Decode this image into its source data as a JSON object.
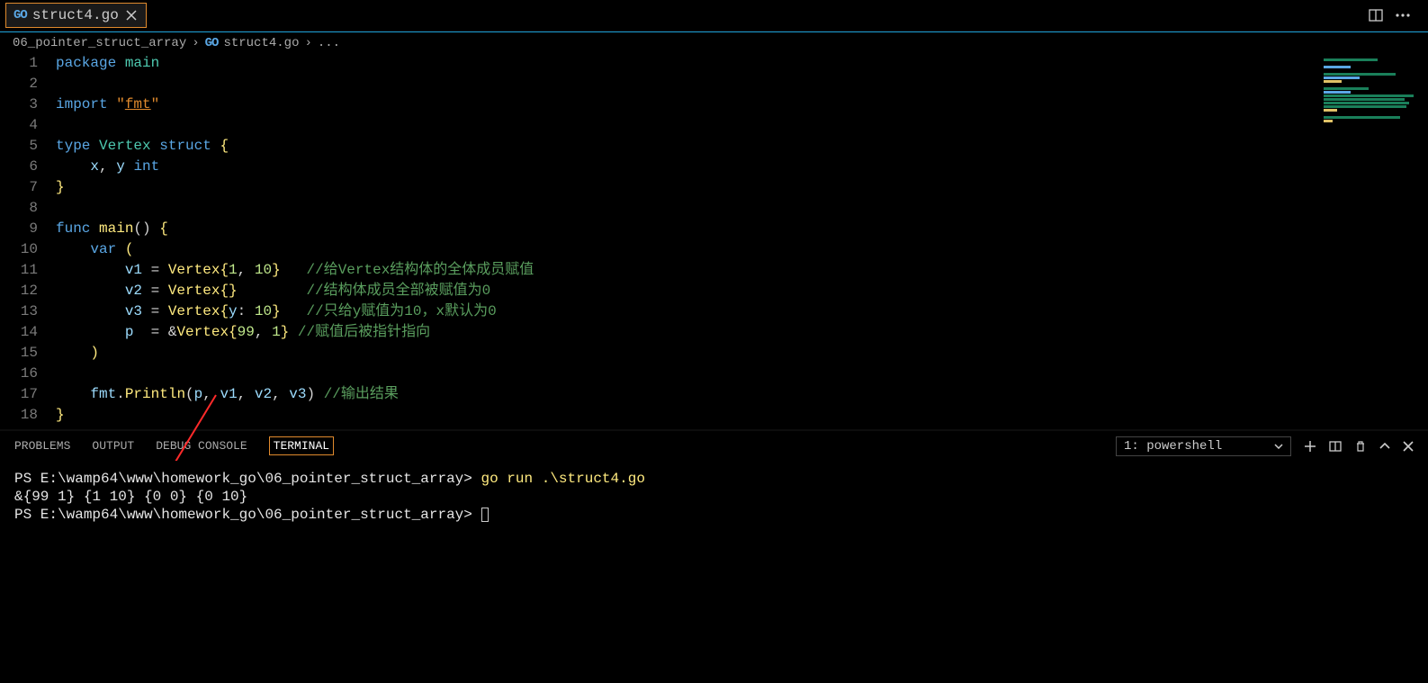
{
  "tabBar": {
    "activeTab": {
      "icon": "GO",
      "label": "struct4.go"
    }
  },
  "breadcrumb": {
    "folder": "06_pointer_struct_array",
    "file": "struct4.go",
    "trail": "..."
  },
  "codeLines": [
    {
      "n": "1",
      "tokens": [
        [
          "kw",
          "package"
        ],
        [
          "pln",
          " "
        ],
        [
          "ty",
          "main"
        ]
      ]
    },
    {
      "n": "2",
      "tokens": []
    },
    {
      "n": "3",
      "tokens": [
        [
          "kw",
          "import"
        ],
        [
          "pln",
          " "
        ],
        [
          "str2",
          "\""
        ],
        [
          "str",
          "fmt"
        ],
        [
          "str2",
          "\""
        ]
      ]
    },
    {
      "n": "4",
      "tokens": []
    },
    {
      "n": "5",
      "tokens": [
        [
          "kw",
          "type"
        ],
        [
          "pln",
          " "
        ],
        [
          "ty",
          "Vertex"
        ],
        [
          "pln",
          " "
        ],
        [
          "kw",
          "struct"
        ],
        [
          "pln",
          " "
        ],
        [
          "brc",
          "{"
        ]
      ]
    },
    {
      "n": "6",
      "tokens": [
        [
          "pln",
          "    "
        ],
        [
          "var",
          "x"
        ],
        [
          "pln",
          ", "
        ],
        [
          "var",
          "y"
        ],
        [
          "pln",
          " "
        ],
        [
          "kw",
          "int"
        ]
      ]
    },
    {
      "n": "7",
      "tokens": [
        [
          "brc",
          "}"
        ]
      ]
    },
    {
      "n": "8",
      "tokens": []
    },
    {
      "n": "9",
      "tokens": [
        [
          "kw",
          "func"
        ],
        [
          "pln",
          " "
        ],
        [
          "fn",
          "main"
        ],
        [
          "pln",
          "() "
        ],
        [
          "brc",
          "{"
        ]
      ]
    },
    {
      "n": "10",
      "tokens": [
        [
          "pln",
          "    "
        ],
        [
          "kw",
          "var"
        ],
        [
          "pln",
          " "
        ],
        [
          "brc",
          "("
        ]
      ]
    },
    {
      "n": "11",
      "tokens": [
        [
          "pln",
          "        "
        ],
        [
          "var",
          "v1"
        ],
        [
          "pln",
          " = "
        ],
        [
          "fn",
          "Vertex"
        ],
        [
          "brc",
          "{"
        ],
        [
          "num",
          "1"
        ],
        [
          "pln",
          ", "
        ],
        [
          "num",
          "10"
        ],
        [
          "brc",
          "}"
        ],
        [
          "pln",
          "   "
        ],
        [
          "com",
          "//给Vertex结构体的全体成员赋值"
        ]
      ]
    },
    {
      "n": "12",
      "tokens": [
        [
          "pln",
          "        "
        ],
        [
          "var",
          "v2"
        ],
        [
          "pln",
          " = "
        ],
        [
          "fn",
          "Vertex"
        ],
        [
          "brc",
          "{}"
        ],
        [
          "pln",
          "        "
        ],
        [
          "com",
          "//结构体成员全部被赋值为0"
        ]
      ]
    },
    {
      "n": "13",
      "tokens": [
        [
          "pln",
          "        "
        ],
        [
          "var",
          "v3"
        ],
        [
          "pln",
          " = "
        ],
        [
          "fn",
          "Vertex"
        ],
        [
          "brc",
          "{"
        ],
        [
          "var",
          "y"
        ],
        [
          "pln",
          ": "
        ],
        [
          "num",
          "10"
        ],
        [
          "brc",
          "}"
        ],
        [
          "pln",
          "   "
        ],
        [
          "com",
          "//只给y赋值为10，x默认为0"
        ]
      ]
    },
    {
      "n": "14",
      "tokens": [
        [
          "pln",
          "        "
        ],
        [
          "var",
          "p"
        ],
        [
          "pln",
          "  = "
        ],
        [
          "op",
          "&"
        ],
        [
          "fn",
          "Vertex"
        ],
        [
          "brc",
          "{"
        ],
        [
          "num",
          "99"
        ],
        [
          "pln",
          ", "
        ],
        [
          "num",
          "1"
        ],
        [
          "brc",
          "}"
        ],
        [
          "pln",
          " "
        ],
        [
          "com",
          "//赋值后被指针指向"
        ]
      ]
    },
    {
      "n": "15",
      "tokens": [
        [
          "pln",
          "    "
        ],
        [
          "brc",
          ")"
        ]
      ]
    },
    {
      "n": "16",
      "tokens": []
    },
    {
      "n": "17",
      "tokens": [
        [
          "pln",
          "    "
        ],
        [
          "var",
          "fmt"
        ],
        [
          "pln",
          "."
        ],
        [
          "fn",
          "Println"
        ],
        [
          "pln",
          "("
        ],
        [
          "var",
          "p"
        ],
        [
          "pln",
          ", "
        ],
        [
          "var",
          "v1"
        ],
        [
          "pln",
          ", "
        ],
        [
          "var",
          "v2"
        ],
        [
          "pln",
          ", "
        ],
        [
          "var",
          "v3"
        ],
        [
          "pln",
          ") "
        ],
        [
          "com",
          "//输出结果"
        ]
      ]
    },
    {
      "n": "18",
      "tokens": [
        [
          "brc",
          "}"
        ]
      ]
    }
  ],
  "panel": {
    "tabs": {
      "problems": "PROBLEMS",
      "output": "OUTPUT",
      "debug": "DEBUG CONSOLE",
      "terminal": "TERMINAL"
    },
    "terminalSelect": "1: powershell",
    "prompt1Path": "PS E:\\wamp64\\www\\homework_go\\06_pointer_struct_array>",
    "cmd1": "go run .\\struct4.go",
    "outputLine": "&{99 1} {1 10} {0 0} {0 10}",
    "prompt2Path": "PS E:\\wamp64\\www\\homework_go\\06_pointer_struct_array>"
  }
}
